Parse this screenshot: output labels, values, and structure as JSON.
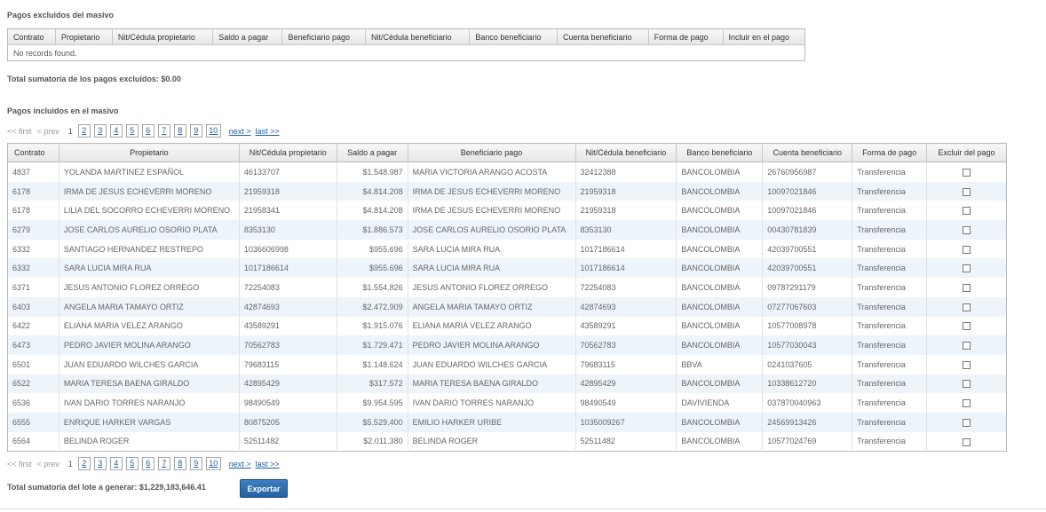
{
  "excluded_section": {
    "title": "Pagos excluidos del masivo",
    "columns": [
      "Contrato",
      "Propietario",
      "Nit/Cédula propietario",
      "Saldo a pagar",
      "Beneficiario pago",
      "Nit/Cédula beneficiario",
      "Banco beneficiario",
      "Cuenta beneficiario",
      "Forma de pago",
      "Incluir en el pago"
    ],
    "empty_message": "No records found.",
    "total_label": "Total sumatoria de los pagos excluidos: $0.00"
  },
  "included_section": {
    "title": "Pagos incluidos en el masivo",
    "columns": [
      "Contrato",
      "Propietario",
      "Nit/Cédula propietario",
      "Saldo a pagar",
      "Beneficiario pago",
      "Nit/Cédula beneficiario",
      "Banco beneficiario",
      "Cuenta beneficiario",
      "Forma de pago",
      "Excluir del pago"
    ],
    "rows": [
      [
        "4837",
        "YOLANDA MARTINEZ ESPAÑOL",
        "46133707",
        "$1.548.987",
        "MARIA VICTORIA ARANGO ACOSTA",
        "32412388",
        "BANCOLOMBIA",
        "26760956987",
        "Transferencia"
      ],
      [
        "6178",
        "IRMA DE JESUS ECHEVERRI MORENO",
        "21959318",
        "$4.814.208",
        "IRMA DE JESUS ECHEVERRI MORENO",
        "21959318",
        "BANCOLOMBIA",
        "10097021846",
        "Transferencia"
      ],
      [
        "6178",
        "LILIA DEL SOCORRO ECHEVERRI MORENO",
        "21958341",
        "$4.814.208",
        "IRMA DE JESUS ECHEVERRI MORENO",
        "21959318",
        "BANCOLOMBIA",
        "10097021846",
        "Transferencia"
      ],
      [
        "6279",
        "JOSE CARLOS AURELIO OSORIO PLATA",
        "8353130",
        "$1.886.573",
        "JOSE CARLOS AURELIO OSORIO PLATA",
        "8353130",
        "BANCOLOMBIA",
        "00430781839",
        "Transferencia"
      ],
      [
        "6332",
        "SANTIAGO HERNANDEZ RESTREPO",
        "1036606998",
        "$955.696",
        "SARA LUCIA MIRA RUA",
        "1017186614",
        "BANCOLOMBIA",
        "42039700551",
        "Transferencia"
      ],
      [
        "6332",
        "SARA LUCIA MIRA RUA",
        "1017186614",
        "$955.696",
        "SARA LUCIA MIRA RUA",
        "1017186614",
        "BANCOLOMBIA",
        "42039700551",
        "Transferencia"
      ],
      [
        "6371",
        "JESUS ANTONIO FLOREZ ORREGO",
        "72254083",
        "$1.554.826",
        "JESUS ANTONIO FLOREZ ORREGO",
        "72254083",
        "BANCOLOMBIA",
        "09787291179",
        "Transferencia"
      ],
      [
        "6403",
        "ANGELA MARIA TAMAYO ORTIZ",
        "42874693",
        "$2.472.909",
        "ANGELA MARIA TAMAYO ORTIZ",
        "42874693",
        "BANCOLOMBIA",
        "07277067603",
        "Transferencia"
      ],
      [
        "6422",
        "ELIANA MARIA VELEZ ARANGO",
        "43589291",
        "$1.915.076",
        "ELIANA MARIA VELEZ ARANGO",
        "43589291",
        "BANCOLOMBIA",
        "10577008978",
        "Transferencia"
      ],
      [
        "6473",
        "PEDRO JAVIER MOLINA ARANGO",
        "70562783",
        "$1.729.471",
        "PEDRO JAVIER MOLINA ARANGO",
        "70562783",
        "BANCOLOMBIA",
        "10577030043",
        "Transferencia"
      ],
      [
        "6501",
        "JUAN EDUARDO WILCHES GARCIA",
        "79683115",
        "$1.148.624",
        "JUAN EDUARDO WILCHES GARCIA",
        "79683115",
        "BBVA",
        "0241037605",
        "Transferencia"
      ],
      [
        "6522",
        "MARIA TERESA BAENA GIRALDO",
        "42895429",
        "$317.572",
        "MARIA TERESA BAENA GIRALDO",
        "42895429",
        "BANCOLOMBIA",
        "10338612720",
        "Transferencia"
      ],
      [
        "6536",
        "IVAN DARIO TORRES NARANJO",
        "98490549",
        "$9.954.595",
        "IVAN DARIO TORRES NARANJO",
        "98490549",
        "DAVIVIENDA",
        "037870040963",
        "Transferencia"
      ],
      [
        "6555",
        "ENRIQUE HARKER VARGAS",
        "80875205",
        "$5.529.400",
        "EMILIO HARKER URIBE",
        "1035009267",
        "BANCOLOMBIA",
        "24569913426",
        "Transferencia"
      ],
      [
        "6564",
        "BELINDA ROGER",
        "52511482",
        "$2.011.380",
        "BELINDA ROGER",
        "52511482",
        "BANCOLOMBIA",
        "10577024769",
        "Transferencia"
      ]
    ],
    "total_label": "Total sumatoria del lote a generar: $1,229,183,646.41",
    "export_label": "Exportar"
  },
  "paginator": {
    "first": "<< first",
    "prev": "< prev",
    "current": "1",
    "pages": [
      "2",
      "3",
      "4",
      "5",
      "6",
      "7",
      "8",
      "9",
      "10"
    ],
    "next": "next >",
    "last": "last >>"
  }
}
